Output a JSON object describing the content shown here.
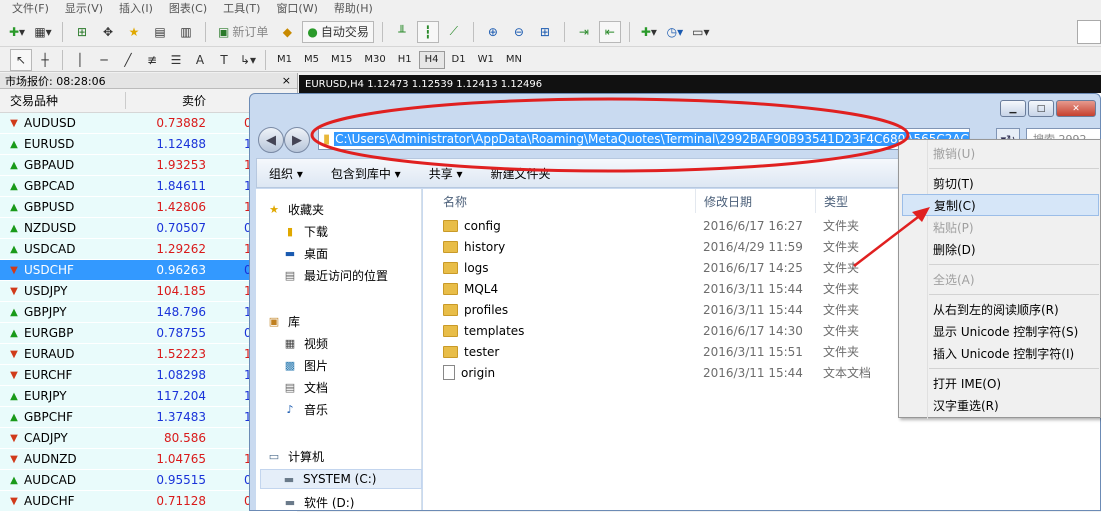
{
  "menu": [
    "文件(F)",
    "显示(V)",
    "插入(I)",
    "图表(C)",
    "工具(T)",
    "窗口(W)",
    "帮助(H)"
  ],
  "toolbar": {
    "new_order": "新订单",
    "auto_trade": "自动交易"
  },
  "timeframes": [
    "M1",
    "M5",
    "M15",
    "M30",
    "H1",
    "H4",
    "D1",
    "W1",
    "MN"
  ],
  "active_timeframe": "H4",
  "market_watch": {
    "title": "市场报价: 08:28:06",
    "close": "×",
    "col_symbol": "交易品种",
    "col_bid": "卖价",
    "rows": [
      {
        "symbol": "AUDUSD",
        "bid": "0.73882",
        "ask": "0",
        "dir": "down",
        "color": "red"
      },
      {
        "symbol": "EURUSD",
        "bid": "1.12488",
        "ask": "1",
        "dir": "up",
        "color": "blue"
      },
      {
        "symbol": "GBPAUD",
        "bid": "1.93253",
        "ask": "1",
        "dir": "up",
        "color": "red"
      },
      {
        "symbol": "GBPCAD",
        "bid": "1.84611",
        "ask": "1",
        "dir": "up",
        "color": "blue"
      },
      {
        "symbol": "GBPUSD",
        "bid": "1.42806",
        "ask": "1",
        "dir": "up",
        "color": "red"
      },
      {
        "symbol": "NZDUSD",
        "bid": "0.70507",
        "ask": "0",
        "dir": "up",
        "color": "blue"
      },
      {
        "symbol": "USDCAD",
        "bid": "1.29262",
        "ask": "1",
        "dir": "up",
        "color": "red"
      },
      {
        "symbol": "USDCHF",
        "bid": "0.96263",
        "ask": "0",
        "dir": "down",
        "color": "blue",
        "selected": true
      },
      {
        "symbol": "USDJPY",
        "bid": "104.185",
        "ask": "1",
        "dir": "down",
        "color": "red"
      },
      {
        "symbol": "GBPJPY",
        "bid": "148.796",
        "ask": "1",
        "dir": "up",
        "color": "blue"
      },
      {
        "symbol": "EURGBP",
        "bid": "0.78755",
        "ask": "0",
        "dir": "up",
        "color": "blue"
      },
      {
        "symbol": "EURAUD",
        "bid": "1.52223",
        "ask": "1",
        "dir": "down",
        "color": "red"
      },
      {
        "symbol": "EURCHF",
        "bid": "1.08298",
        "ask": "1",
        "dir": "down",
        "color": "blue"
      },
      {
        "symbol": "EURJPY",
        "bid": "117.204",
        "ask": "1",
        "dir": "up",
        "color": "blue"
      },
      {
        "symbol": "GBPCHF",
        "bid": "1.37483",
        "ask": "1",
        "dir": "up",
        "color": "blue"
      },
      {
        "symbol": "CADJPY",
        "bid": "80.586",
        "ask": "",
        "dir": "down",
        "color": "red"
      },
      {
        "symbol": "AUDNZD",
        "bid": "1.04765",
        "ask": "1",
        "dir": "down",
        "color": "red"
      },
      {
        "symbol": "AUDCAD",
        "bid": "0.95515",
        "ask": "0",
        "dir": "up",
        "color": "blue"
      },
      {
        "symbol": "AUDCHF",
        "bid": "0.71128",
        "ask": "0",
        "dir": "down",
        "color": "red"
      }
    ]
  },
  "chart": {
    "header": "EURUSD,H4  1.12473 1.12539 1.12413 1.12496"
  },
  "explorer": {
    "address": "C:\\Users\\Administrator\\AppData\\Roaming\\MetaQuotes\\Terminal\\2992BAF90B93541D23F4C680A565C2AC",
    "search_placeholder": "搜索 2992...",
    "commands": [
      "组织 ▾",
      "包含到库中 ▾",
      "共享 ▾",
      "新建文件夹"
    ],
    "nav": {
      "favorites": "收藏夹",
      "downloads": "下载",
      "desktop": "桌面",
      "recent": "最近访问的位置",
      "libraries": "库",
      "videos": "视频",
      "pictures": "图片",
      "documents": "文档",
      "music": "音乐",
      "computer": "计算机",
      "system_c": "SYSTEM (C:)",
      "software_d": "软件 (D:)"
    },
    "columns": {
      "name": "名称",
      "date": "修改日期",
      "type": "类型"
    },
    "files": [
      {
        "name": "config",
        "date": "2016/6/17 16:27",
        "type": "文件夹",
        "kind": "folder"
      },
      {
        "name": "history",
        "date": "2016/4/29 11:59",
        "type": "文件夹",
        "kind": "folder"
      },
      {
        "name": "logs",
        "date": "2016/6/17 14:25",
        "type": "文件夹",
        "kind": "folder"
      },
      {
        "name": "MQL4",
        "date": "2016/3/11 15:44",
        "type": "文件夹",
        "kind": "folder"
      },
      {
        "name": "profiles",
        "date": "2016/3/11 15:44",
        "type": "文件夹",
        "kind": "folder"
      },
      {
        "name": "templates",
        "date": "2016/6/17 14:30",
        "type": "文件夹",
        "kind": "folder"
      },
      {
        "name": "tester",
        "date": "2016/3/11 15:51",
        "type": "文件夹",
        "kind": "folder"
      },
      {
        "name": "origin",
        "date": "2016/3/11 15:44",
        "type": "文本文档",
        "kind": "doc"
      }
    ]
  },
  "context_menu": {
    "undo": "撤销(U)",
    "cut": "剪切(T)",
    "copy": "复制(C)",
    "paste": "粘贴(P)",
    "delete": "删除(D)",
    "select_all": "全选(A)",
    "rtl": "从右到左的阅读顺序(R)",
    "show_unicode": "显示 Unicode 控制字符(S)",
    "insert_unicode": "插入 Unicode 控制字符(I)",
    "open_ime": "打开 IME(O)",
    "reconversion": "汉字重选(R)"
  },
  "colors": {
    "selection": "#3399ff",
    "annotation": "#e02020",
    "bid_red": "#d91a1a",
    "bid_blue": "#1a33d9"
  }
}
